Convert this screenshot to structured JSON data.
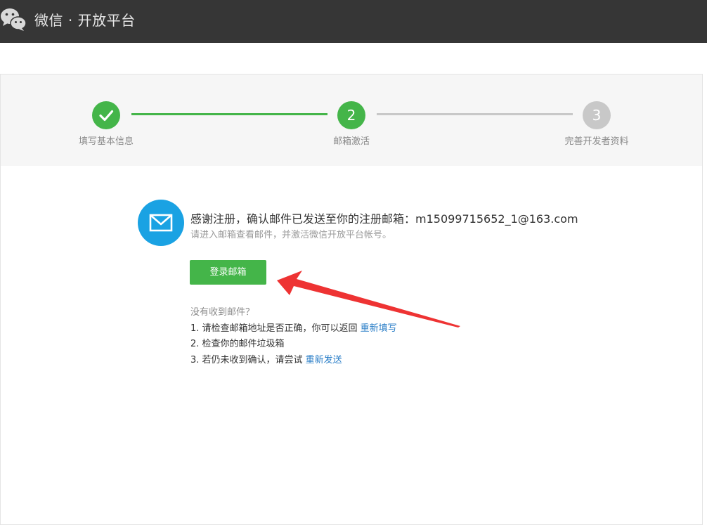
{
  "header": {
    "brand": "微信 · 开放平台",
    "logo_icon": "wechat-logo-icon"
  },
  "steps": [
    {
      "label": "填写基本信息",
      "number": "",
      "status": "done",
      "icon": "check-icon"
    },
    {
      "label": "邮箱激活",
      "number": "2",
      "status": "current"
    },
    {
      "label": "完善开发者资料",
      "number": "3",
      "status": "pending"
    }
  ],
  "message": {
    "icon": "envelope-icon",
    "headline": "感谢注册，确认邮件已发送至你的注册邮箱：m15099715652_1@163.com",
    "subline": "请进入邮箱查看邮件，并激活微信开放平台帐号。"
  },
  "login_button": {
    "label": "登录邮箱"
  },
  "help": {
    "question": "没有收到邮件？",
    "item1_text": "1. 请检查邮箱地址是否正确，你可以返回 ",
    "item1_link": "重新填写",
    "item2_text": "2. 检查你的邮件垃圾箱",
    "item3_text": "3. 若仍未收到确认，请尝试 ",
    "item3_link": "重新发送"
  },
  "colors": {
    "topbar": "#363636",
    "accent_green": "#44b549",
    "mail_blue": "#1aa2e3",
    "link_blue": "#2a7ec7",
    "step_gray": "#c8c8c8",
    "annotation_arrow": "#ee3333"
  }
}
